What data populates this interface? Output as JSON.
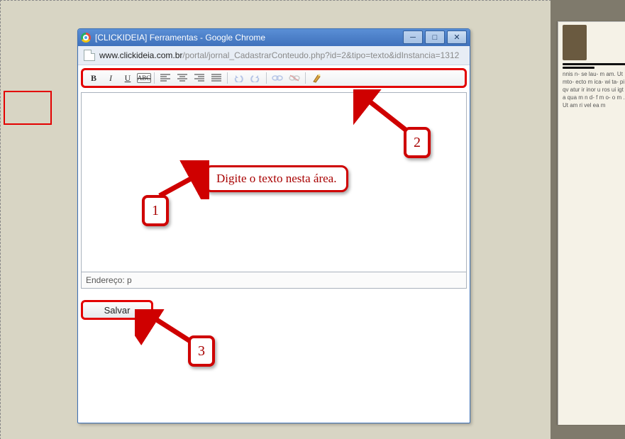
{
  "window": {
    "title": "[CLICKIDEIA] Ferramentas - Google Chrome",
    "url_host": "www.clickideia.com.br",
    "url_path": "/portal/jornal_CadastrarConteudo.php?id=2&tipo=texto&idInstancia=1312"
  },
  "toolbar": {
    "bold": "B",
    "italic": "I",
    "underline": "U",
    "strike": "ABC"
  },
  "editor": {
    "status_label": "Endereço: p"
  },
  "buttons": {
    "save": "Salvar"
  },
  "annotations": {
    "hint": "Digite o texto nesta área.",
    "n1": "1",
    "n2": "2",
    "n3": "3"
  }
}
